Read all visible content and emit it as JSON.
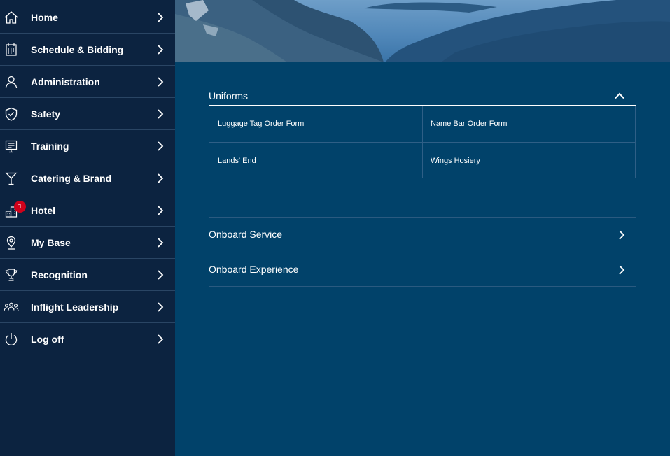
{
  "sidebar": {
    "items": [
      {
        "label": "Home",
        "icon": "home-icon"
      },
      {
        "label": "Schedule & Bidding",
        "icon": "calendar-icon"
      },
      {
        "label": "Administration",
        "icon": "person-icon"
      },
      {
        "label": "Safety",
        "icon": "shield-icon"
      },
      {
        "label": "Training",
        "icon": "training-icon"
      },
      {
        "label": "Catering & Brand",
        "icon": "cocktail-glass-icon"
      },
      {
        "label": "Hotel",
        "icon": "hotel-building-icon",
        "badge": "1"
      },
      {
        "label": "My Base",
        "icon": "location-pin-icon"
      },
      {
        "label": "Recognition",
        "icon": "trophy-icon"
      },
      {
        "label": "Inflight Leadership",
        "icon": "group-icon"
      },
      {
        "label": "Log off",
        "icon": "power-icon"
      }
    ]
  },
  "main": {
    "uniforms": {
      "title": "Uniforms",
      "expanded": true,
      "links": [
        "Luggage Tag Order Form",
        "Name Bar Order Form",
        "Lands' End",
        "Wings Hosiery"
      ]
    },
    "collapsed_sections": [
      {
        "label": "Onboard Service"
      },
      {
        "label": "Onboard Experience"
      }
    ]
  },
  "colors": {
    "sidebar_bg": "#0c2340",
    "main_bg": "#01426a",
    "badge": "#d0021b",
    "divider": "#2a4564"
  }
}
